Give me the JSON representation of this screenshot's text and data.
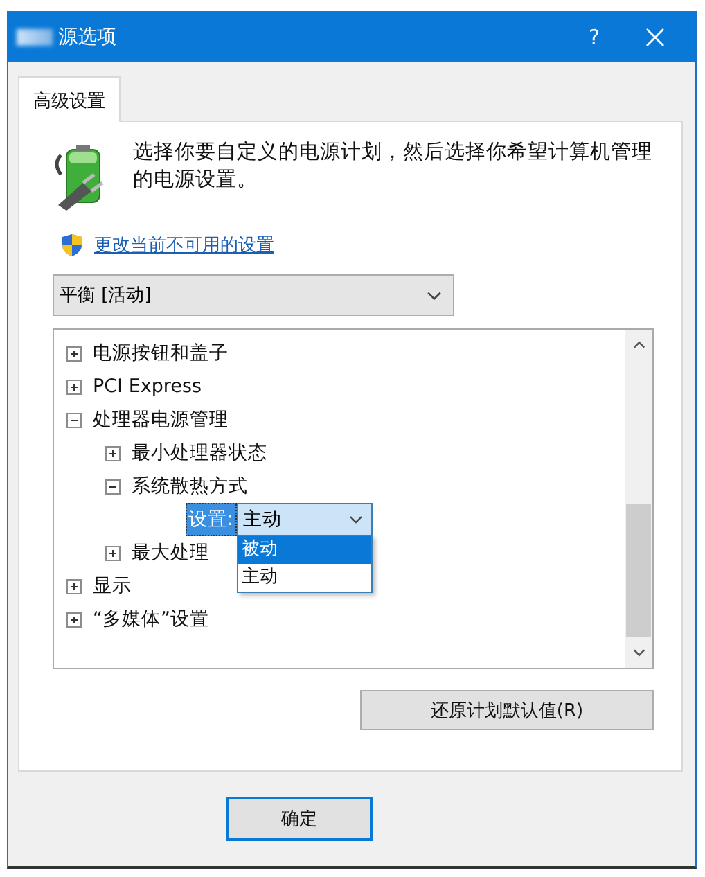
{
  "window": {
    "title": "源选项",
    "help": "?"
  },
  "tabs": [
    {
      "label": "高级设置",
      "selected": true
    }
  ],
  "description": "选择你要自定义的电源计划，然后选择你希望计算机管理的电源设置。",
  "link": "更改当前不可用的设置",
  "plan_dropdown": {
    "value": "平衡 [活动]"
  },
  "tree": [
    {
      "kind": "group",
      "label": "电源按钮和盖子",
      "expanded": false
    },
    {
      "kind": "group",
      "label": "PCI Express",
      "expanded": false
    },
    {
      "kind": "group",
      "label": "处理器电源管理",
      "expanded": true,
      "children": [
        {
          "kind": "group",
          "label": "最小处理器状态",
          "expanded": false
        },
        {
          "kind": "group",
          "label": "系统散热方式",
          "expanded": true,
          "children": [
            {
              "kind": "setting",
              "label": "设置:",
              "selected": true,
              "value": "主动",
              "open": true,
              "options": [
                {
                  "label": "被动",
                  "highlighted": true
                },
                {
                  "label": "主动",
                  "highlighted": false
                }
              ]
            }
          ]
        },
        {
          "kind": "group",
          "label": "最大处理",
          "expanded": false
        }
      ]
    },
    {
      "kind": "group",
      "label": "显示",
      "expanded": false
    },
    {
      "kind": "group",
      "label": "“多媒体”设置",
      "expanded": false
    }
  ],
  "buttons": {
    "restore": "还原计划默认值(R)",
    "ok": "确定"
  }
}
